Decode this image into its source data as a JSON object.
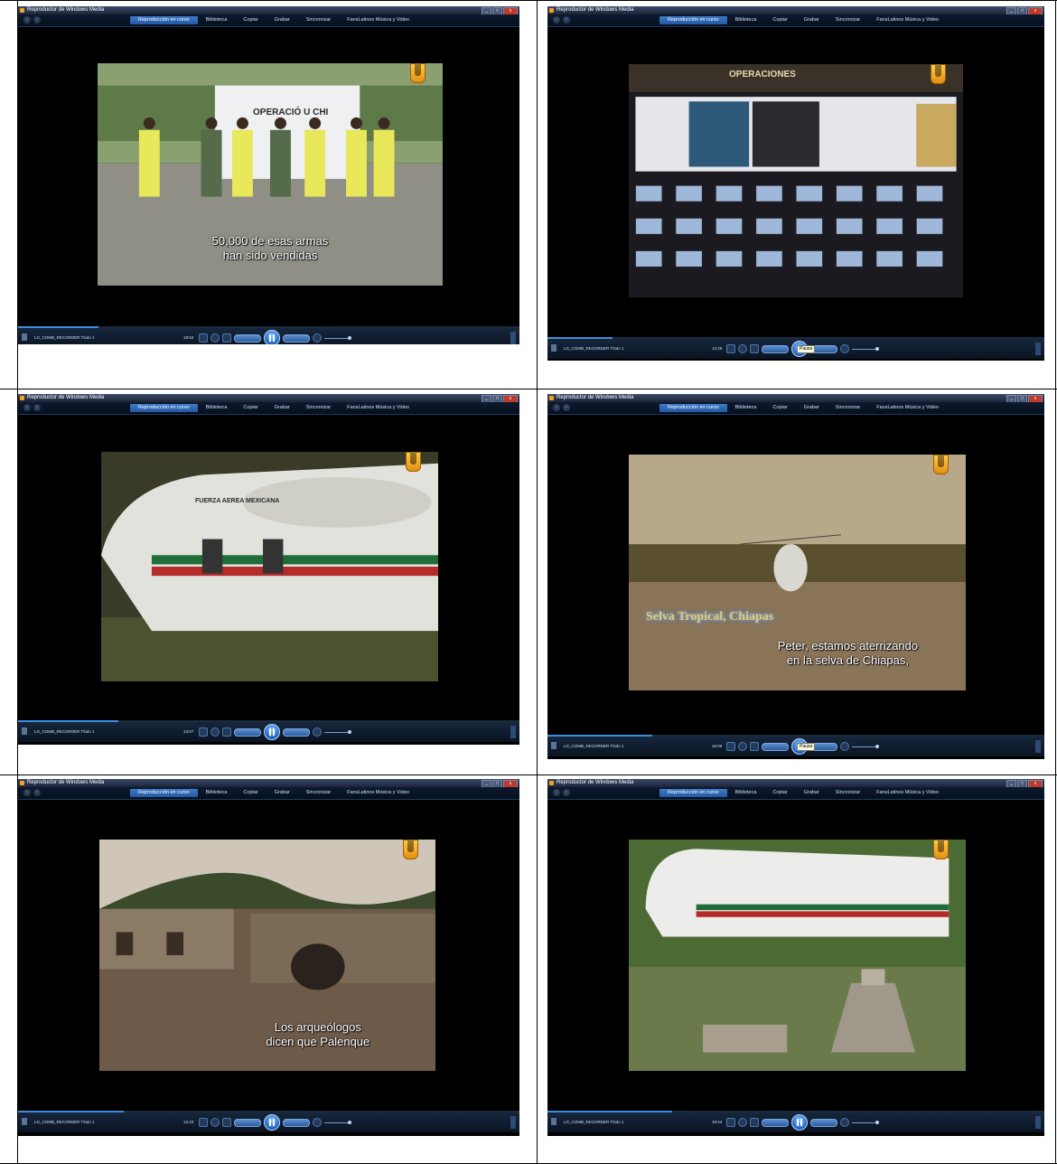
{
  "window": {
    "title": "Reproductor de Windows Media",
    "minimize": "_",
    "maximize": "□",
    "close": "x"
  },
  "nav": {
    "tabs": [
      "Reproducción en curso",
      "Biblioteca",
      "Copiar",
      "Grabar",
      "Sincronizar",
      "FansLatinos Música y Video"
    ]
  },
  "player": {
    "track_name": "LG_COMB_RECORDER Título 1",
    "tooltip": "Pausa",
    "logo": "U"
  },
  "frames": [
    {
      "id": "f1",
      "time": "18:53",
      "progress": 0.16,
      "subtitle_lines": [
        "50,000 de esas armas",
        "han sido vendidas"
      ],
      "scene": "detainees-in-yellow",
      "banner_text": [
        "OPERACIÓ",
        "U",
        "CHI"
      ]
    },
    {
      "id": "f2",
      "time": "12:26",
      "progress": 0.13,
      "subtitle_lines": [],
      "scene": "operations-room",
      "banner_text": [
        "OPERACIONES"
      ],
      "show_tooltip": true
    },
    {
      "id": "f3",
      "time": "13:07",
      "progress": 0.2,
      "subtitle_lines": [],
      "scene": "helicopter-side",
      "banner_text": [
        "FUERZA AEREA MEXICANA"
      ]
    },
    {
      "id": "f4",
      "time": "16:06",
      "progress": 0.21,
      "subtitle_lines": [
        "Peter, estamos aterrizando",
        "en la selva de Chiapas,"
      ],
      "caption": "Selva Tropical, Chiapas",
      "scene": "helicopter-landing",
      "show_tooltip": true
    },
    {
      "id": "f5",
      "time": "13:23",
      "progress": 0.21,
      "subtitle_lines": [
        "Los arqueólogos",
        "dicen que Palenque"
      ],
      "scene": "palenque-ruins"
    },
    {
      "id": "f6",
      "time": "19:44",
      "progress": 0.25,
      "subtitle_lines": [],
      "scene": "helicopter-over-pyramid"
    }
  ],
  "colors": {
    "accent": "#2a6fd0",
    "logo": "#f0a020",
    "chrome": "#0a1422"
  }
}
